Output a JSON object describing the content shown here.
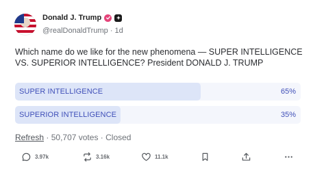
{
  "post": {
    "author_name": "Donald J. Trump",
    "handle": "@realDonaldTrump",
    "separator": "·",
    "age": "1d",
    "text": "Which name do we like for the new phenomena — SUPER INTELLIGENCE VS. SUPERIOR INTELLIGENCE? President DONALD J. TRUMP"
  },
  "poll": {
    "options": [
      {
        "label": "SUPER INTELLIGENCE",
        "percent_text": "65%",
        "percent": 65
      },
      {
        "label": "SUPERIOR INTELLIGENCE",
        "percent_text": "35%",
        "percent": 35
      }
    ],
    "refresh_label": "Refresh",
    "votes_text": "50,707 votes",
    "status": "Closed",
    "separator": "·"
  },
  "actions": {
    "reply_count": "3.97k",
    "repost_count": "3.16k",
    "like_count": "11.1k"
  },
  "colors": {
    "poll_fill": "#dde5f8",
    "poll_track": "#f4f6fc",
    "poll_text": "#3f4fb8",
    "verified_badge": "#e5457a"
  },
  "icons": {
    "reply": "comment-bubble-icon",
    "repost": "repost-arrows-icon",
    "like": "heart-icon",
    "bookmark": "bookmark-icon",
    "share": "share-upload-icon",
    "more": "ellipsis-icon"
  }
}
